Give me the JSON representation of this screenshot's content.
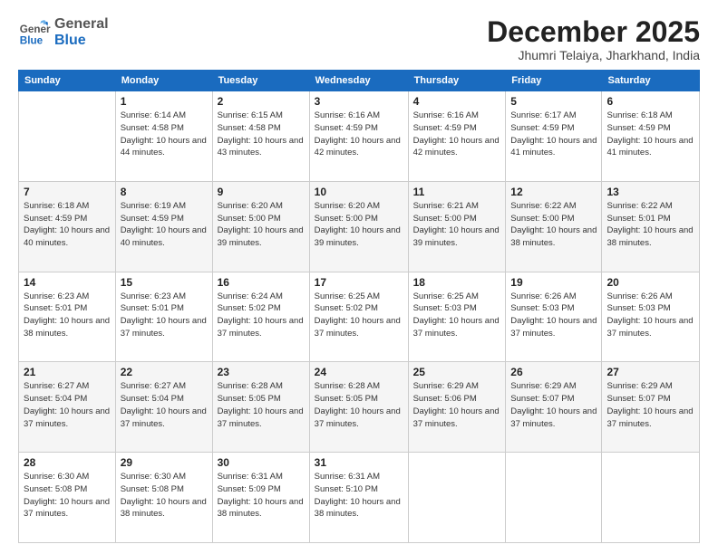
{
  "header": {
    "logo_general": "General",
    "logo_blue": "Blue",
    "month_title": "December 2025",
    "location": "Jhumri Telaiya, Jharkhand, India"
  },
  "weekdays": [
    "Sunday",
    "Monday",
    "Tuesday",
    "Wednesday",
    "Thursday",
    "Friday",
    "Saturday"
  ],
  "weeks": [
    [
      {
        "day": "",
        "sunrise": "",
        "sunset": "",
        "daylight": ""
      },
      {
        "day": "1",
        "sunrise": "Sunrise: 6:14 AM",
        "sunset": "Sunset: 4:58 PM",
        "daylight": "Daylight: 10 hours and 44 minutes."
      },
      {
        "day": "2",
        "sunrise": "Sunrise: 6:15 AM",
        "sunset": "Sunset: 4:58 PM",
        "daylight": "Daylight: 10 hours and 43 minutes."
      },
      {
        "day": "3",
        "sunrise": "Sunrise: 6:16 AM",
        "sunset": "Sunset: 4:59 PM",
        "daylight": "Daylight: 10 hours and 42 minutes."
      },
      {
        "day": "4",
        "sunrise": "Sunrise: 6:16 AM",
        "sunset": "Sunset: 4:59 PM",
        "daylight": "Daylight: 10 hours and 42 minutes."
      },
      {
        "day": "5",
        "sunrise": "Sunrise: 6:17 AM",
        "sunset": "Sunset: 4:59 PM",
        "daylight": "Daylight: 10 hours and 41 minutes."
      },
      {
        "day": "6",
        "sunrise": "Sunrise: 6:18 AM",
        "sunset": "Sunset: 4:59 PM",
        "daylight": "Daylight: 10 hours and 41 minutes."
      }
    ],
    [
      {
        "day": "7",
        "sunrise": "Sunrise: 6:18 AM",
        "sunset": "Sunset: 4:59 PM",
        "daylight": "Daylight: 10 hours and 40 minutes."
      },
      {
        "day": "8",
        "sunrise": "Sunrise: 6:19 AM",
        "sunset": "Sunset: 4:59 PM",
        "daylight": "Daylight: 10 hours and 40 minutes."
      },
      {
        "day": "9",
        "sunrise": "Sunrise: 6:20 AM",
        "sunset": "Sunset: 5:00 PM",
        "daylight": "Daylight: 10 hours and 39 minutes."
      },
      {
        "day": "10",
        "sunrise": "Sunrise: 6:20 AM",
        "sunset": "Sunset: 5:00 PM",
        "daylight": "Daylight: 10 hours and 39 minutes."
      },
      {
        "day": "11",
        "sunrise": "Sunrise: 6:21 AM",
        "sunset": "Sunset: 5:00 PM",
        "daylight": "Daylight: 10 hours and 39 minutes."
      },
      {
        "day": "12",
        "sunrise": "Sunrise: 6:22 AM",
        "sunset": "Sunset: 5:00 PM",
        "daylight": "Daylight: 10 hours and 38 minutes."
      },
      {
        "day": "13",
        "sunrise": "Sunrise: 6:22 AM",
        "sunset": "Sunset: 5:01 PM",
        "daylight": "Daylight: 10 hours and 38 minutes."
      }
    ],
    [
      {
        "day": "14",
        "sunrise": "Sunrise: 6:23 AM",
        "sunset": "Sunset: 5:01 PM",
        "daylight": "Daylight: 10 hours and 38 minutes."
      },
      {
        "day": "15",
        "sunrise": "Sunrise: 6:23 AM",
        "sunset": "Sunset: 5:01 PM",
        "daylight": "Daylight: 10 hours and 37 minutes."
      },
      {
        "day": "16",
        "sunrise": "Sunrise: 6:24 AM",
        "sunset": "Sunset: 5:02 PM",
        "daylight": "Daylight: 10 hours and 37 minutes."
      },
      {
        "day": "17",
        "sunrise": "Sunrise: 6:25 AM",
        "sunset": "Sunset: 5:02 PM",
        "daylight": "Daylight: 10 hours and 37 minutes."
      },
      {
        "day": "18",
        "sunrise": "Sunrise: 6:25 AM",
        "sunset": "Sunset: 5:03 PM",
        "daylight": "Daylight: 10 hours and 37 minutes."
      },
      {
        "day": "19",
        "sunrise": "Sunrise: 6:26 AM",
        "sunset": "Sunset: 5:03 PM",
        "daylight": "Daylight: 10 hours and 37 minutes."
      },
      {
        "day": "20",
        "sunrise": "Sunrise: 6:26 AM",
        "sunset": "Sunset: 5:03 PM",
        "daylight": "Daylight: 10 hours and 37 minutes."
      }
    ],
    [
      {
        "day": "21",
        "sunrise": "Sunrise: 6:27 AM",
        "sunset": "Sunset: 5:04 PM",
        "daylight": "Daylight: 10 hours and 37 minutes."
      },
      {
        "day": "22",
        "sunrise": "Sunrise: 6:27 AM",
        "sunset": "Sunset: 5:04 PM",
        "daylight": "Daylight: 10 hours and 37 minutes."
      },
      {
        "day": "23",
        "sunrise": "Sunrise: 6:28 AM",
        "sunset": "Sunset: 5:05 PM",
        "daylight": "Daylight: 10 hours and 37 minutes."
      },
      {
        "day": "24",
        "sunrise": "Sunrise: 6:28 AM",
        "sunset": "Sunset: 5:05 PM",
        "daylight": "Daylight: 10 hours and 37 minutes."
      },
      {
        "day": "25",
        "sunrise": "Sunrise: 6:29 AM",
        "sunset": "Sunset: 5:06 PM",
        "daylight": "Daylight: 10 hours and 37 minutes."
      },
      {
        "day": "26",
        "sunrise": "Sunrise: 6:29 AM",
        "sunset": "Sunset: 5:07 PM",
        "daylight": "Daylight: 10 hours and 37 minutes."
      },
      {
        "day": "27",
        "sunrise": "Sunrise: 6:29 AM",
        "sunset": "Sunset: 5:07 PM",
        "daylight": "Daylight: 10 hours and 37 minutes."
      }
    ],
    [
      {
        "day": "28",
        "sunrise": "Sunrise: 6:30 AM",
        "sunset": "Sunset: 5:08 PM",
        "daylight": "Daylight: 10 hours and 37 minutes."
      },
      {
        "day": "29",
        "sunrise": "Sunrise: 6:30 AM",
        "sunset": "Sunset: 5:08 PM",
        "daylight": "Daylight: 10 hours and 38 minutes."
      },
      {
        "day": "30",
        "sunrise": "Sunrise: 6:31 AM",
        "sunset": "Sunset: 5:09 PM",
        "daylight": "Daylight: 10 hours and 38 minutes."
      },
      {
        "day": "31",
        "sunrise": "Sunrise: 6:31 AM",
        "sunset": "Sunset: 5:10 PM",
        "daylight": "Daylight: 10 hours and 38 minutes."
      },
      {
        "day": "",
        "sunrise": "",
        "sunset": "",
        "daylight": ""
      },
      {
        "day": "",
        "sunrise": "",
        "sunset": "",
        "daylight": ""
      },
      {
        "day": "",
        "sunrise": "",
        "sunset": "",
        "daylight": ""
      }
    ]
  ]
}
